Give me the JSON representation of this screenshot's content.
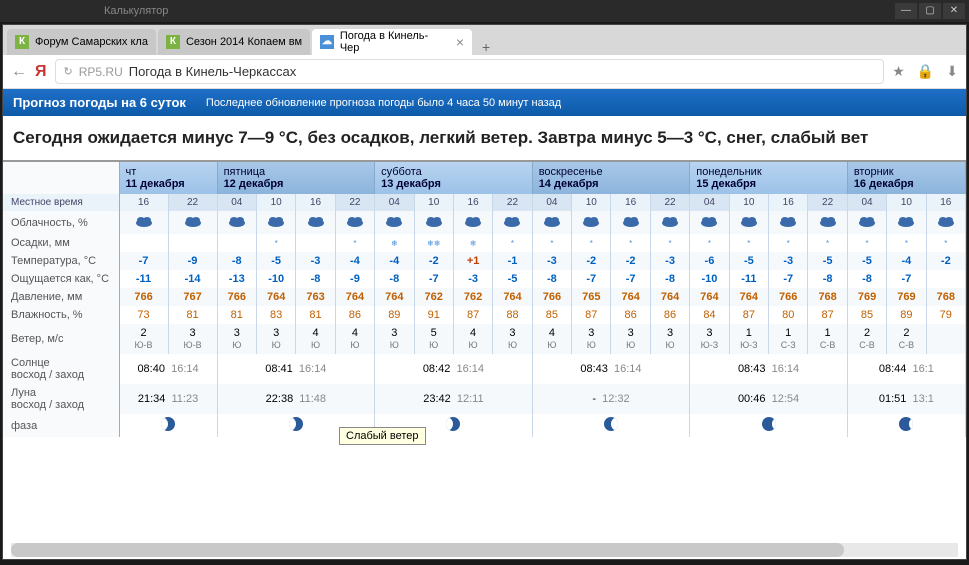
{
  "titlebar": {
    "apps": [
      "",
      "Калькулятор"
    ]
  },
  "tabs": [
    {
      "icon": "К",
      "iconClass": "tab-icon",
      "label": "Форум Самарских кла",
      "active": false,
      "close": false
    },
    {
      "icon": "К",
      "iconClass": "tab-icon",
      "label": "Сезон 2014 Копаем вм",
      "active": false,
      "close": false
    },
    {
      "icon": "☁",
      "iconClass": "tab-icon wx",
      "label": "Погода в Кинель-Чер",
      "active": true,
      "close": true
    }
  ],
  "address": {
    "domain": "RP5.RU",
    "title": "Погода в Кинель-Черкассах"
  },
  "header": {
    "title": "Прогноз погоды на 6 суток",
    "sub": "Последнее обновление прогноза погоды было 4 часа 50 минут назад"
  },
  "summary": "Сегодня ожидается минус 7—9 °C, без осадков, легкий ветер. Завтра минус 5—3 °C, снег, слабый вет",
  "days": [
    {
      "name": "чт",
      "date": "11 декабря",
      "span": 2
    },
    {
      "name": "пятница",
      "date": "12 декабря",
      "span": 4
    },
    {
      "name": "суббота",
      "date": "13 декабря",
      "span": 4
    },
    {
      "name": "воскресенье",
      "date": "14 декабря",
      "span": 4
    },
    {
      "name": "понедельник",
      "date": "15 декабря",
      "span": 4
    },
    {
      "name": "вторник",
      "date": "16 декабря",
      "span": 3
    }
  ],
  "rows": {
    "labels": {
      "time": "Местное время",
      "cloud": "Облачность, %",
      "precip": "Осадки, мм",
      "temp": "Температура, °C",
      "feels": "Ощущается как, °C",
      "press": "Давление, мм",
      "hum": "Влажность, %",
      "wind": "Ветер, м/с",
      "sun": "Солнце\nвосход / заход",
      "moon": "Луна\nвосход / заход",
      "phase": "фаза"
    }
  },
  "hours": [
    "16",
    "22",
    "04",
    "10",
    "16",
    "22",
    "04",
    "10",
    "16",
    "22",
    "04",
    "10",
    "16",
    "22",
    "04",
    "10",
    "16",
    "22",
    "04",
    "10",
    "16"
  ],
  "night": [
    0,
    1,
    1,
    0,
    0,
    1,
    1,
    0,
    0,
    1,
    1,
    0,
    0,
    1,
    1,
    0,
    0,
    1,
    1,
    0,
    0
  ],
  "precip": [
    "",
    "",
    "",
    "*",
    "",
    "*",
    "❄",
    "❄❄",
    "❄",
    "*",
    "*",
    "*",
    "*",
    "*",
    "*",
    "*",
    "*",
    "*",
    "*",
    "*",
    "*"
  ],
  "temp": [
    "-7",
    "-9",
    "-8",
    "-5",
    "-3",
    "-4",
    "-4",
    "-2",
    "+1",
    "-1",
    "-3",
    "-2",
    "-2",
    "-3",
    "-6",
    "-5",
    "-3",
    "-5",
    "-5",
    "-4",
    "-2"
  ],
  "feels": [
    "-11",
    "-14",
    "-13",
    "-10",
    "-8",
    "-9",
    "-8",
    "-7",
    "-3",
    "-5",
    "-8",
    "-7",
    "-7",
    "-8",
    "-10",
    "-11",
    "-7",
    "-8",
    "-8",
    "-7",
    ""
  ],
  "press": [
    "766",
    "767",
    "766",
    "764",
    "763",
    "764",
    "764",
    "762",
    "762",
    "764",
    "766",
    "765",
    "764",
    "764",
    "764",
    "764",
    "766",
    "768",
    "769",
    "769",
    "768"
  ],
  "hum": [
    "73",
    "81",
    "81",
    "83",
    "81",
    "86",
    "89",
    "91",
    "87",
    "88",
    "85",
    "87",
    "86",
    "86",
    "84",
    "87",
    "80",
    "87",
    "85",
    "89",
    "79"
  ],
  "windS": [
    "2",
    "3",
    "3",
    "3",
    "4",
    "4",
    "3",
    "5",
    "4",
    "3",
    "4",
    "3",
    "3",
    "3",
    "3",
    "1",
    "1",
    "1",
    "2",
    "2",
    ""
  ],
  "windD": [
    "Ю-В",
    "Ю-В",
    "Ю",
    "Ю",
    "Ю",
    "Ю",
    "Ю",
    "Ю",
    "Ю",
    "Ю",
    "Ю",
    "Ю",
    "Ю",
    "Ю",
    "Ю-З",
    "Ю-З",
    "С-З",
    "С-В",
    "С-В",
    "С-В",
    ""
  ],
  "sun": [
    {
      "span": 2,
      "rise": "08:40",
      "set": "16:14"
    },
    {
      "span": 4,
      "rise": "08:41",
      "set": "16:14"
    },
    {
      "span": 4,
      "rise": "08:42",
      "set": "16:14"
    },
    {
      "span": 4,
      "rise": "08:43",
      "set": "16:14"
    },
    {
      "span": 4,
      "rise": "08:43",
      "set": "16:14"
    },
    {
      "span": 3,
      "rise": "08:44",
      "set": "16:1"
    }
  ],
  "moon": [
    {
      "span": 2,
      "rise": "21:34",
      "set": "11:23"
    },
    {
      "span": 4,
      "rise": "22:38",
      "set": "11:48"
    },
    {
      "span": 4,
      "rise": "23:42",
      "set": "12:11"
    },
    {
      "span": 4,
      "rise": "-",
      "set": "12:32"
    },
    {
      "span": 4,
      "rise": "00:46",
      "set": "12:54"
    },
    {
      "span": 3,
      "rise": "01:51",
      "set": "13:1"
    }
  ],
  "phase": [
    "wax",
    "wax",
    "wax",
    "wan",
    "cres",
    "cres"
  ],
  "tooltip": "Слабый ветер"
}
